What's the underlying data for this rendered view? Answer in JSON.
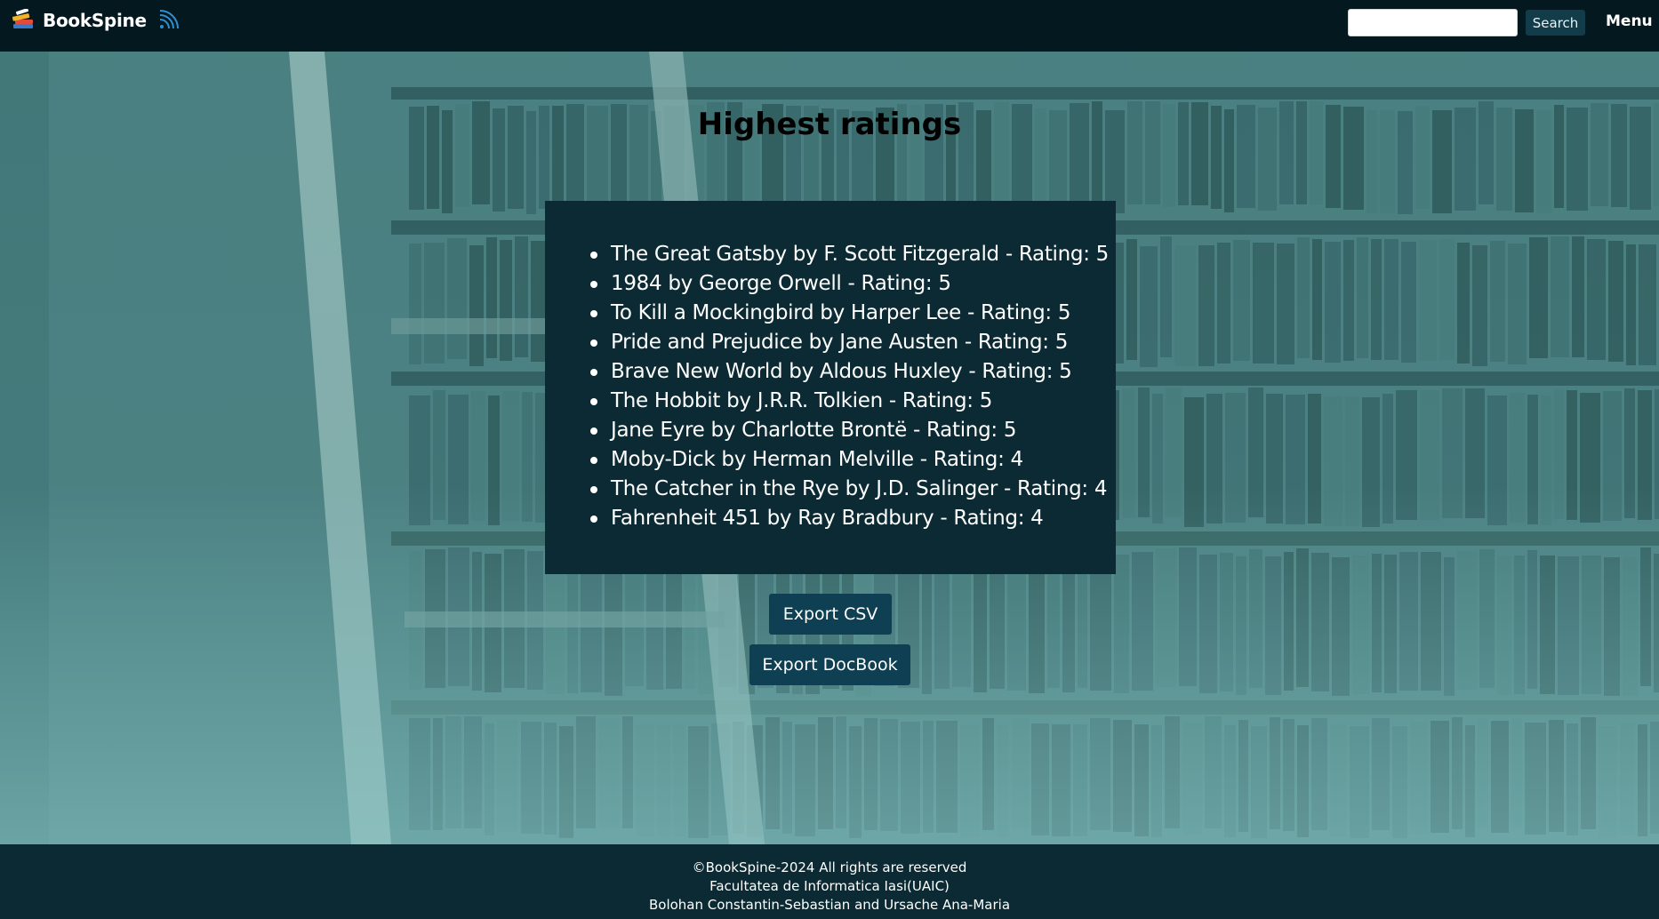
{
  "header": {
    "brand_name": "BookSpine",
    "logo_icon": "books-stack-icon",
    "rss_icon": "rss-feed-icon",
    "search": {
      "value": "",
      "placeholder": ""
    },
    "search_button_label": "Search",
    "menu_label": "Menu"
  },
  "main": {
    "title": "Highest ratings",
    "ratings": [
      "The Great Gatsby by F. Scott Fitzgerald - Rating: 5",
      "1984 by George Orwell - Rating: 5",
      "To Kill a Mockingbird by Harper Lee - Rating: 5",
      "Pride and Prejudice by Jane Austen - Rating: 5",
      "Brave New World by Aldous Huxley - Rating: 5",
      "The Hobbit by J.R.R. Tolkien - Rating: 5",
      "Jane Eyre by Charlotte Brontë - Rating: 5",
      "Moby-Dick by Herman Melville - Rating: 4",
      "The Catcher in the Rye by J.D. Salinger - Rating: 4",
      "Fahrenheit 451 by Ray Bradbury - Rating: 4"
    ],
    "export_csv_label": "Export CSV",
    "export_docbook_label": "Export DocBook"
  },
  "footer": {
    "line1": "©BookSpine-2024 All rights are reserved",
    "line2": "Facultatea de Informatica Iasi(UAIC)",
    "line3": "Bolohan Constantin-Sebastian and Ursache Ana-Maria"
  },
  "colors": {
    "header_bg": "#041820",
    "panel_bg": "#0b2a33",
    "button_bg": "#0f3f52",
    "search_button_bg": "#123c4a",
    "footer_bg": "#0b2a33",
    "hero_tint": "#4c8283"
  }
}
